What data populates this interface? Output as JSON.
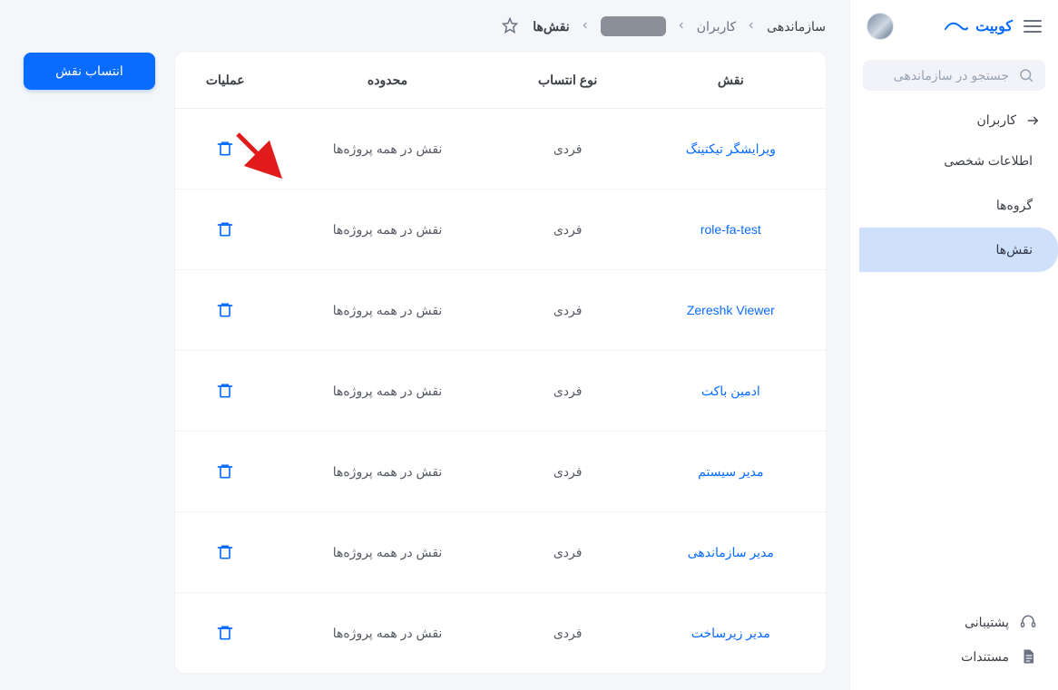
{
  "brand": {
    "name": "کوبیت"
  },
  "search": {
    "placeholder": "جستجو در سازماندهی"
  },
  "nav": {
    "back_label": "کاربران",
    "items": [
      {
        "label": "اطلاعات شخصی"
      },
      {
        "label": "گروه‌ها"
      },
      {
        "label": "نقش‌ها"
      }
    ],
    "active_index": 2
  },
  "sidebar_bottom": {
    "support": "پشتیبانی",
    "docs": "مستندات"
  },
  "breadcrumb": {
    "root": "سازماندهی",
    "section": "کاربران",
    "current": "نقش‌ها"
  },
  "assign_button": "انتساب نقش",
  "table": {
    "headers": {
      "role": "نقش",
      "assign_type": "نوع انتساب",
      "scope": "محدوده",
      "actions": "عملیات"
    },
    "rows": [
      {
        "role": "ویرایشگر تیکتینگ",
        "assign_type": "فردی",
        "scope": "نقش در همه پروژه‌ها"
      },
      {
        "role": "role-fa-test",
        "assign_type": "فردی",
        "scope": "نقش در همه پروژه‌ها"
      },
      {
        "role": "Zereshk Viewer",
        "assign_type": "فردی",
        "scope": "نقش در همه پروژه‌ها"
      },
      {
        "role": "ادمین باکت",
        "assign_type": "فردی",
        "scope": "نقش در همه پروژه‌ها"
      },
      {
        "role": "مدیر سیستم",
        "assign_type": "فردی",
        "scope": "نقش در همه پروژه‌ها"
      },
      {
        "role": "مدیر سازماندهی",
        "assign_type": "فردی",
        "scope": "نقش در همه پروژه‌ها"
      },
      {
        "role": "مدیر زیرساخت",
        "assign_type": "فردی",
        "scope": "نقش در همه پروژه‌ها"
      }
    ]
  },
  "colors": {
    "accent": "#0a6cff",
    "annotation": "#e11b1b"
  }
}
